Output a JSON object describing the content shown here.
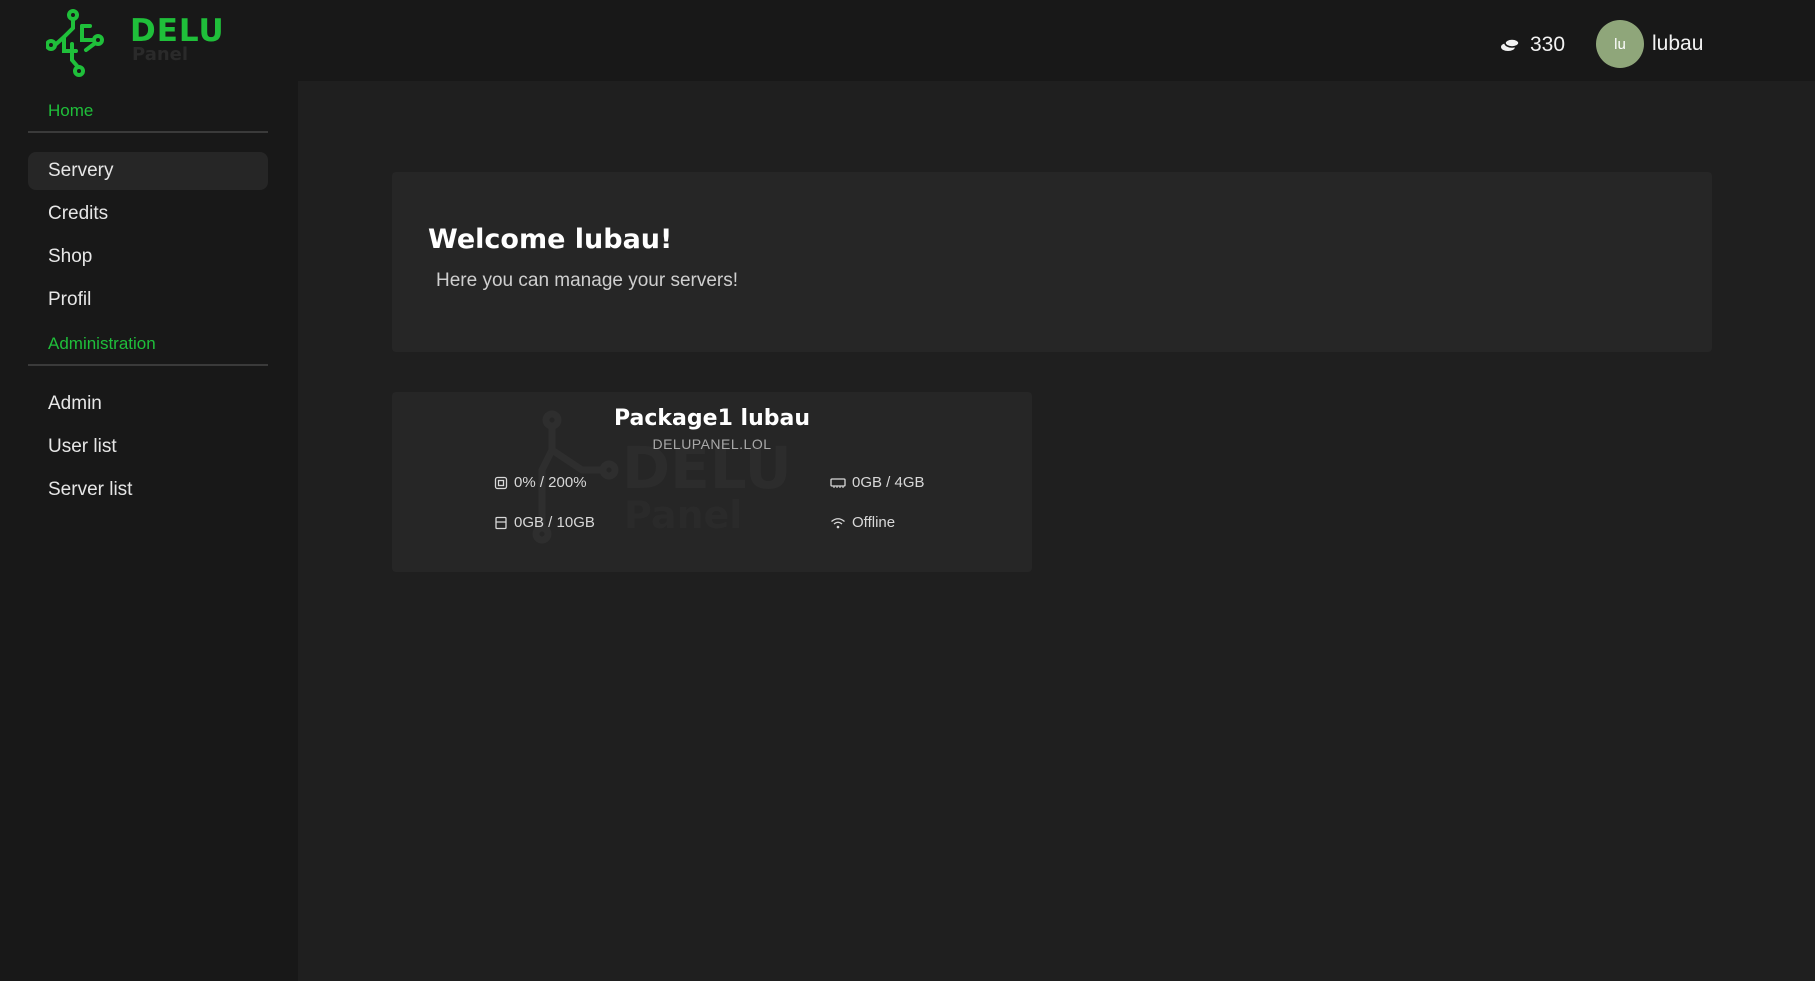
{
  "brand": {
    "name": "DELU",
    "sub": "Panel",
    "accent": "#1fbf3a"
  },
  "header": {
    "credits_icon": "coins-icon",
    "credits": "330",
    "avatar_initials": "lu",
    "username": "lubau"
  },
  "sidebar": {
    "section_home": "Home",
    "items": [
      {
        "label": "Servery",
        "active": true
      },
      {
        "label": "Credits"
      },
      {
        "label": "Shop"
      },
      {
        "label": "Profil"
      }
    ],
    "section_admin": "Administration",
    "admin_items": [
      {
        "label": "Admin"
      },
      {
        "label": "User list"
      },
      {
        "label": "Server list"
      }
    ]
  },
  "welcome": {
    "title": "Welcome lubau!",
    "subtitle": "Here you can manage your servers!"
  },
  "server": {
    "name": "Package1 lubau",
    "host": "DELUPANEL.LOL",
    "cpu": "0% / 200%",
    "ram": "0GB / 4GB",
    "disk": "0GB / 10GB",
    "status": "Offline",
    "watermark_text": "DELU",
    "watermark_sub": "Panel"
  }
}
